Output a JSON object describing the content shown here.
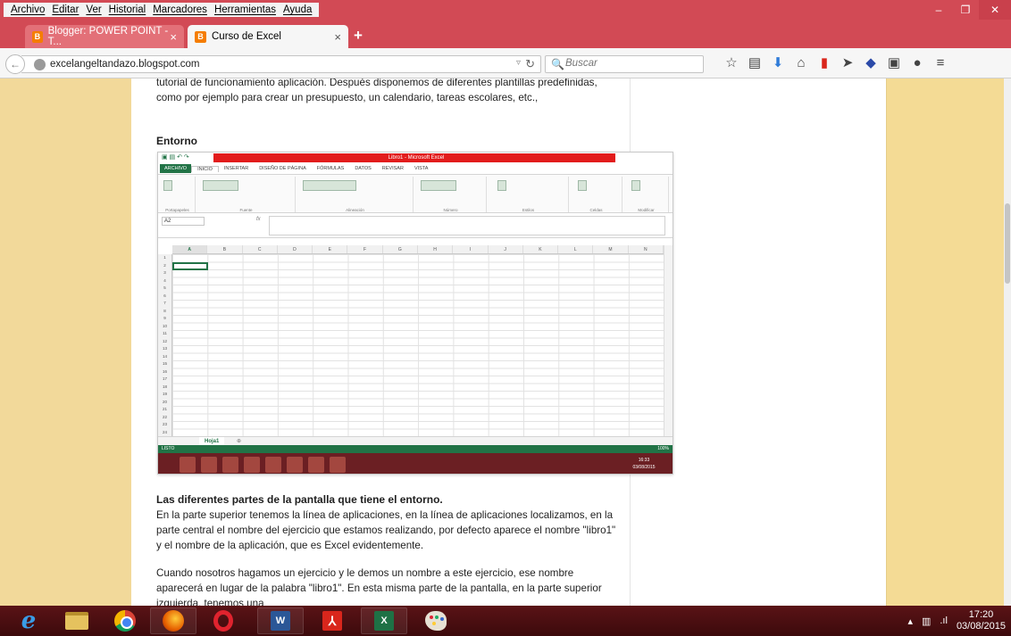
{
  "menu": [
    "Archivo",
    "Editar",
    "Ver",
    "Historial",
    "Marcadores",
    "Herramientas",
    "Ayuda"
  ],
  "window_controls": {
    "minimize": "–",
    "maximize": "❐",
    "close": "✕"
  },
  "tabs": [
    {
      "label": "Blogger: POWER POINT - T...",
      "close": "×"
    },
    {
      "label": "Curso de Excel",
      "close": "×"
    }
  ],
  "new_tab": "+",
  "address": {
    "url": "excelangeltandazo.blogspot.com"
  },
  "search": {
    "placeholder": "Buscar"
  },
  "article": {
    "p1": "tutorial de funcionamiento aplicación. Después disponemos de diferentes plantillas predefinidas, como por ejemplo para crear un presupuesto, un calendario, tareas escolares, etc.,",
    "heading": "Entorno",
    "h2": "Las diferentes partes de la pantalla que tiene el entorno.",
    "p2": "En la parte superior tenemos la línea de aplicaciones, en la línea de aplicaciones localizamos, en la parte central el nombre del ejercicio que estamos realizando, por defecto aparece el nombre \"libro1\" y el nombre de la aplicación, que es Excel evidentemente.",
    "p3": "Cuando nosotros hagamos un ejercicio y le demos un nombre a este ejercicio, ese nombre aparecerá en lugar de la palabra \"libro1\". En esta misma parte de la pantalla, en la parte superior izquierda, tenemos una"
  },
  "excel": {
    "title": "Libro1 - Microsoft Excel",
    "ribbon_tabs": [
      "ARCHIVO",
      "INICIO",
      "INSERTAR",
      "DISEÑO DE PÁGINA",
      "FÓRMULAS",
      "DATOS",
      "REVISAR",
      "VISTA"
    ],
    "groups": [
      "Portapapeles",
      "Fuente",
      "Alineación",
      "Número",
      "Estilos",
      "Celdas",
      "Modificar"
    ],
    "name_box": "A2",
    "fx": "fx",
    "columns": [
      "A",
      "B",
      "C",
      "D",
      "E",
      "F",
      "G",
      "H",
      "I",
      "J",
      "K",
      "L",
      "M",
      "N"
    ],
    "rows": [
      "1",
      "2",
      "3",
      "4",
      "5",
      "6",
      "7",
      "8",
      "9",
      "10",
      "11",
      "12",
      "13",
      "14",
      "15",
      "16",
      "17",
      "18",
      "19",
      "20",
      "21",
      "22",
      "23",
      "24"
    ],
    "sheet": "Hoja1",
    "status": "LISTO",
    "zoom": "100%",
    "clock": "16:33",
    "date": "03/08/2015"
  },
  "taskbar": {
    "time": "17:20",
    "date": "03/08/2015"
  }
}
